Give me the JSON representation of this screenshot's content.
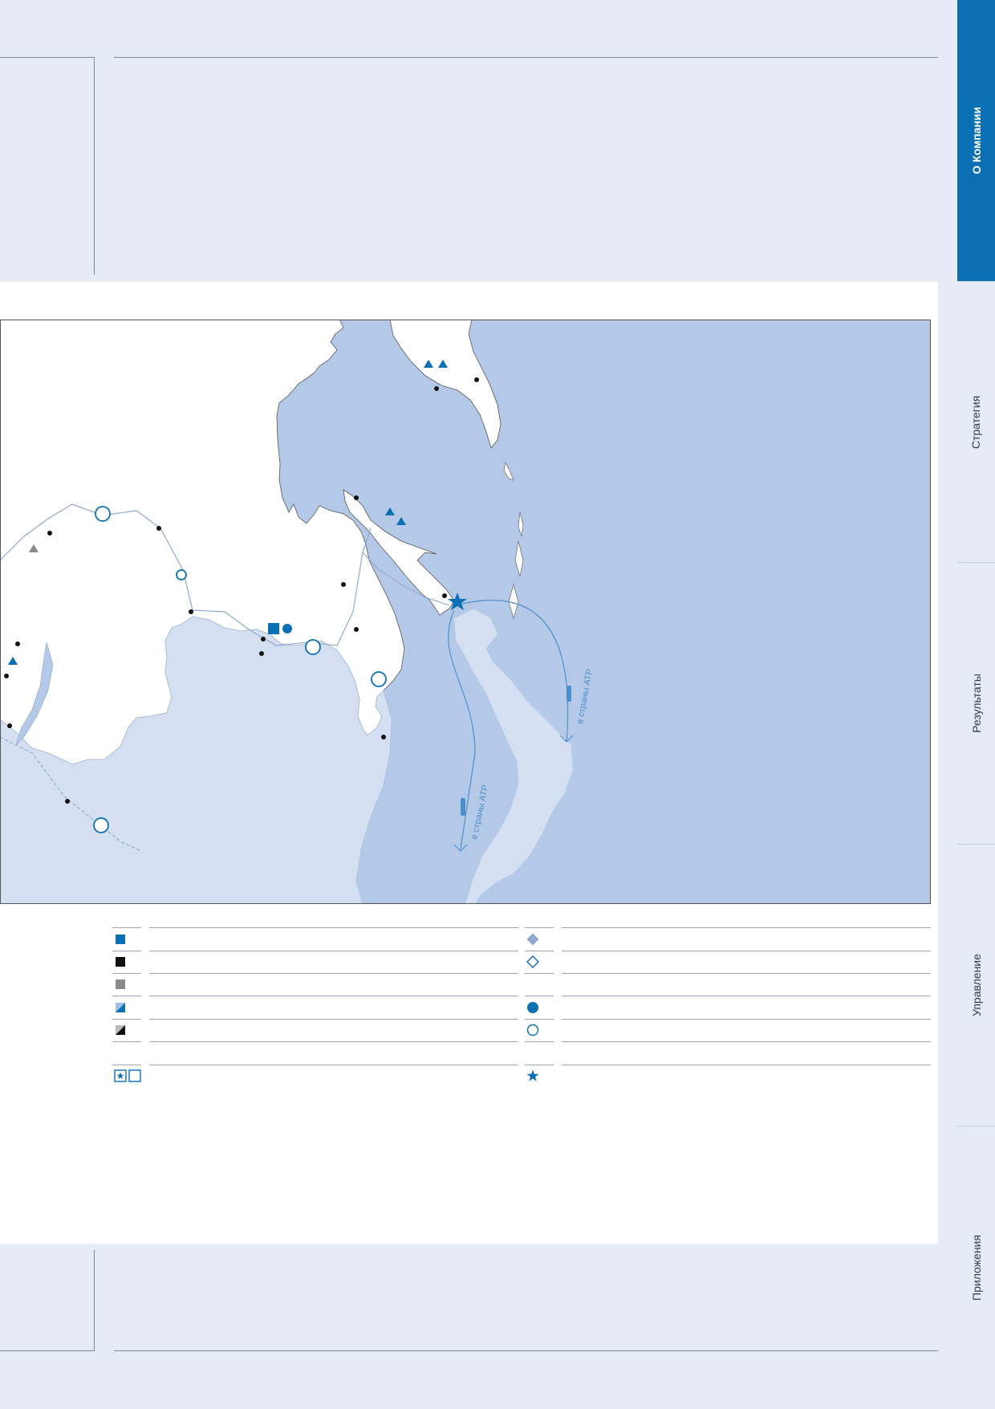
{
  "sidebar": {
    "active_color": "#0b6fb3",
    "tabs": [
      {
        "label": "О Компании",
        "active": true
      },
      {
        "label": "Стратегия",
        "active": false
      },
      {
        "label": "Результаты",
        "active": false
      },
      {
        "label": "Управление",
        "active": false
      },
      {
        "label": "Приложения",
        "active": false
      }
    ]
  },
  "map": {
    "sea_color": "#b4c9e8",
    "land_color": "#ffffff",
    "foreign_land_color": "#d4e0f2",
    "accent_color": "#0b6fb3",
    "route_labels": [
      {
        "text": "в страны АТР"
      },
      {
        "text": "в страны АТР"
      }
    ]
  },
  "legend": {
    "left_symbols": [
      "square-blue",
      "square-black",
      "square-gray",
      "square-blue-half",
      "square-black-half",
      "",
      "star-square-and-empty-square"
    ],
    "right_symbols": [
      "diamond-filled",
      "diamond-outline",
      "",
      "circle-filled",
      "circle-outline",
      "",
      "star"
    ]
  }
}
